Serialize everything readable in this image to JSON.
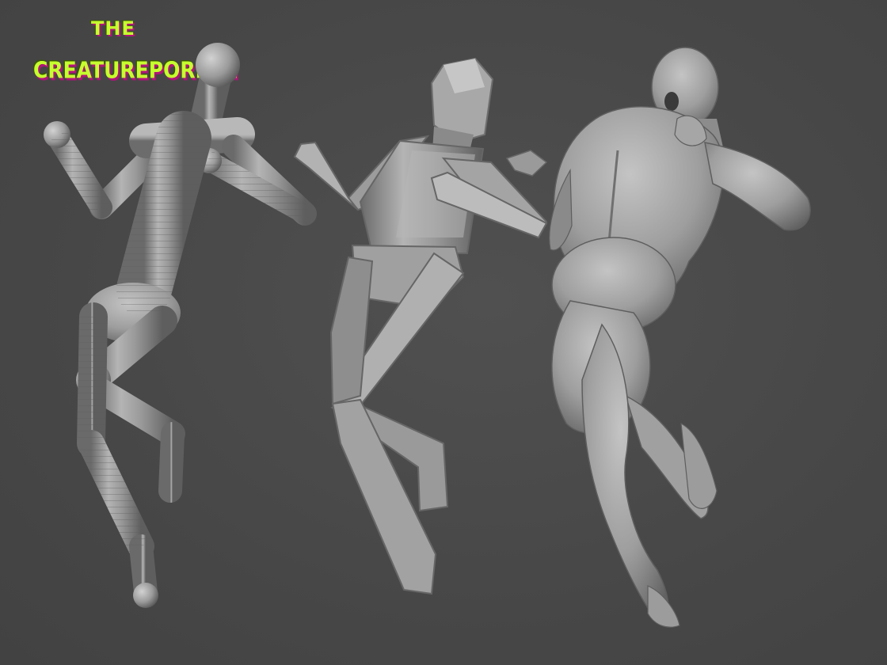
{
  "logo": {
    "line1": "THE",
    "line2": "CREATUREPORIUM"
  },
  "colors": {
    "background": "#4a4a4a",
    "logo_text": "#c6ff2e",
    "logo_shadow": "#b0147a"
  },
  "figures": [
    {
      "name": "segmented-mannequin-figure"
    },
    {
      "name": "low-poly-blockout-figure"
    },
    {
      "name": "sculpted-muscular-figure"
    }
  ]
}
